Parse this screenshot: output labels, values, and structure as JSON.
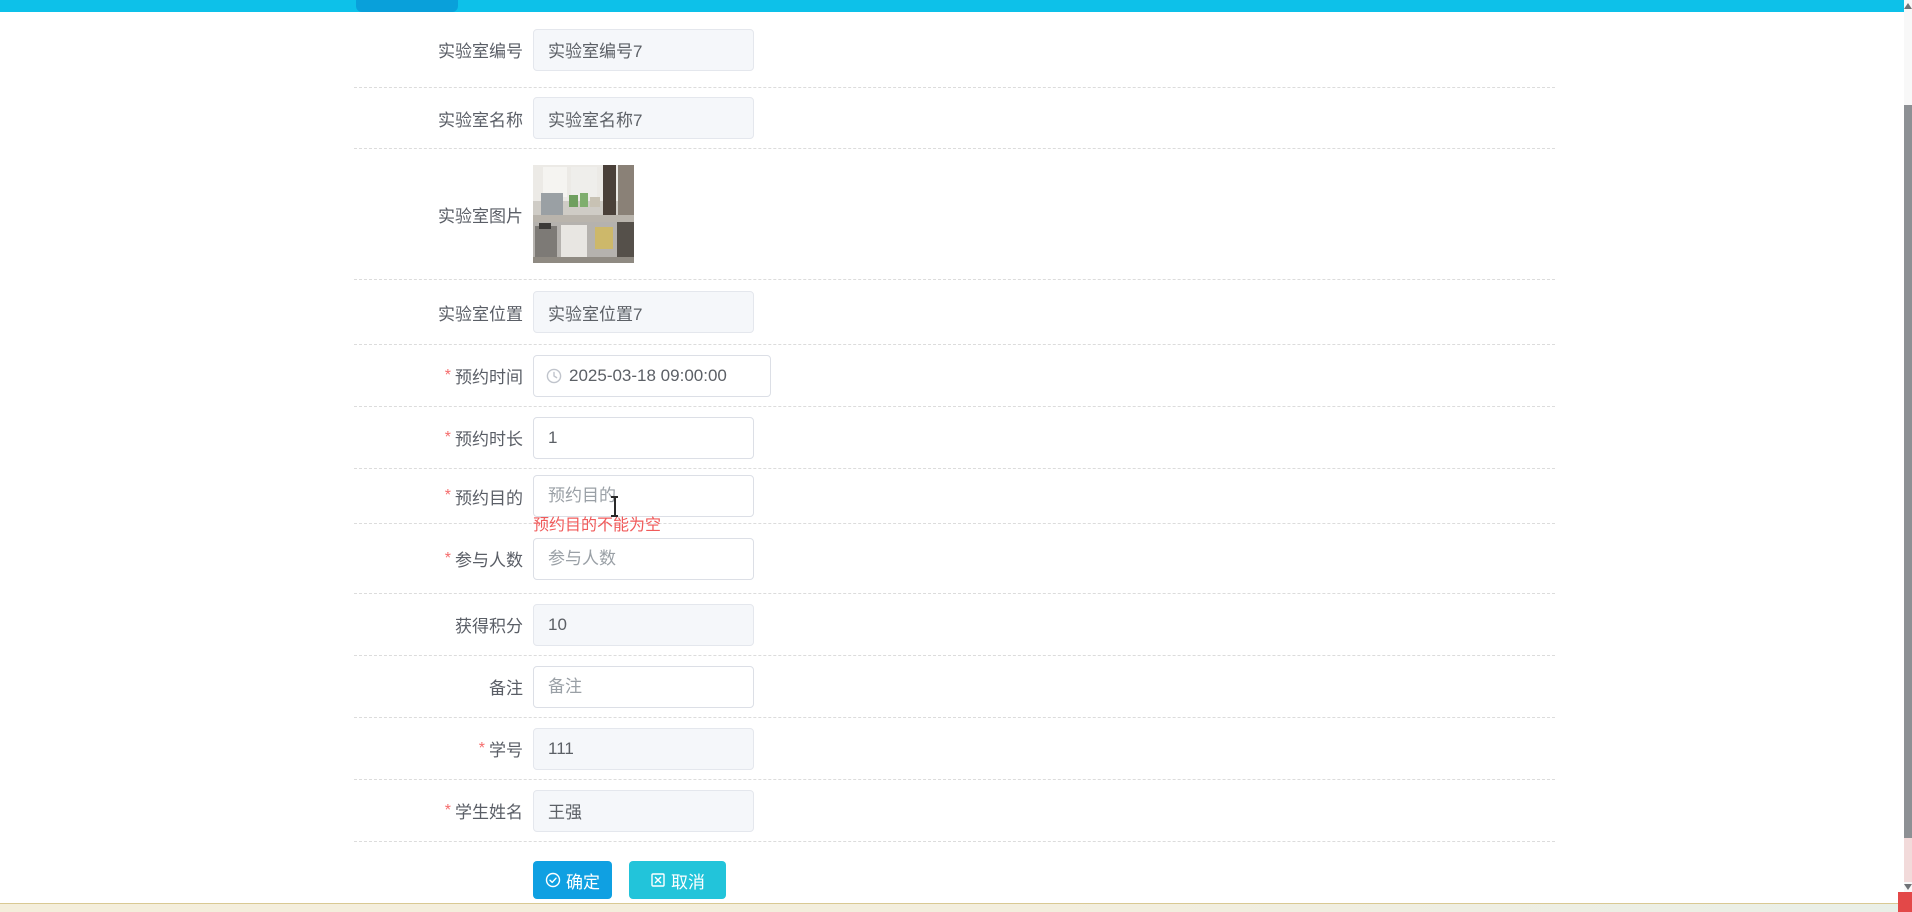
{
  "topbar": {
    "note": "cyan app bar with darker active segment"
  },
  "colors": {
    "topbar": "#0dc1e9",
    "topbar_active_segment": "#09a0da",
    "confirm_button": "#0fa0e2",
    "cancel_button": "#22c4da",
    "error_text": "#f05a5a",
    "required_marker": "#f56c6c"
  },
  "form": {
    "required_marker": "*",
    "fields": [
      {
        "label": "实验室编号",
        "value": "实验室编号7",
        "state": "disabled"
      },
      {
        "label": "实验室名称",
        "value": "实验室名称7",
        "state": "disabled"
      },
      {
        "label": "实验室图片",
        "type": "image",
        "image_alt": "lab-photo"
      },
      {
        "label": "实验室位置",
        "value": "实验室位置7",
        "state": "disabled"
      },
      {
        "label": "预约时间",
        "value": "2025-03-18 09:00:00",
        "required": true,
        "icon": "clock-icon"
      },
      {
        "label": "预约时长",
        "value": "1",
        "required": true
      },
      {
        "label": "预约目的",
        "placeholder": "预约目的",
        "required": true,
        "error": "预约目的不能为空"
      },
      {
        "label": "参与人数",
        "placeholder": "参与人数",
        "required": true
      },
      {
        "label": "获得积分",
        "value": "10",
        "state": "disabled"
      },
      {
        "label": "备注",
        "placeholder": "备注"
      },
      {
        "label": "学号",
        "value": "111",
        "required": true,
        "state": "disabled"
      },
      {
        "label": "学生姓名",
        "value": "王强",
        "required": true,
        "state": "disabled"
      }
    ],
    "buttons": {
      "confirm_label": "确定",
      "cancel_label": "取消",
      "confirm_icon": "check-circle-icon",
      "cancel_icon": "close-square-icon"
    }
  }
}
